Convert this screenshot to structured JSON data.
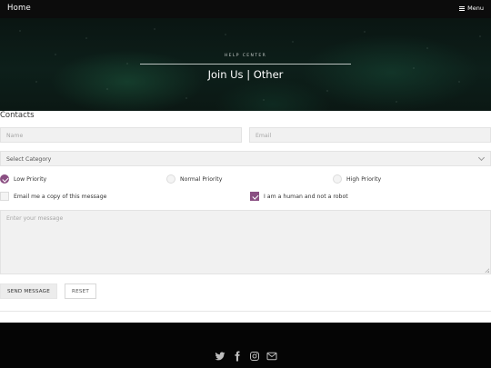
{
  "nav": {
    "home": "Home",
    "menu": "Menu"
  },
  "hero": {
    "kicker": "HELP CENTER",
    "title": "Join Us | Other"
  },
  "form": {
    "section_label": "Contacts",
    "name_placeholder": "Name",
    "email_placeholder": "Email",
    "category_selected": "Select Category",
    "priorities": [
      {
        "label": "Low Priority",
        "checked": true
      },
      {
        "label": "Normal Priority",
        "checked": false
      },
      {
        "label": "High Priority",
        "checked": false
      }
    ],
    "copy_label": "Email me a copy of this message",
    "copy_checked": false,
    "human_label": "I am a human and not a robot",
    "human_checked": true,
    "message_placeholder": "Enter your message",
    "send_label": "SEND MESSAGE",
    "reset_label": "RESET"
  },
  "footer": {
    "social_icons": [
      "twitter-icon",
      "facebook-icon",
      "instagram-icon",
      "mail-icon"
    ]
  },
  "colors": {
    "accent": "#8a4f82",
    "footer_bg": "#050505",
    "topbar_bg": "#0c0c0c"
  }
}
